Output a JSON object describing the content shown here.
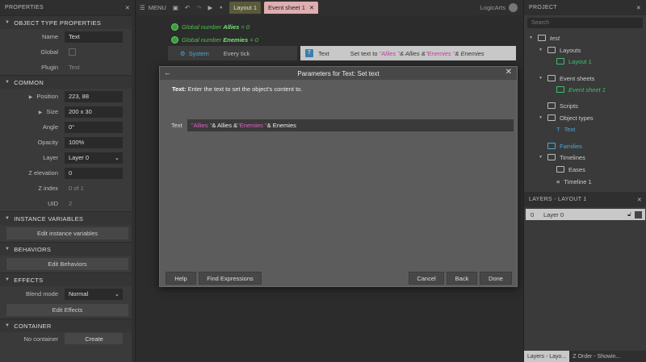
{
  "properties": {
    "title": "PROPERTIES",
    "object_type": {
      "header": "OBJECT TYPE PROPERTIES",
      "name_label": "Name",
      "name_value": "Text",
      "global_label": "Global",
      "plugin_label": "Plugin",
      "plugin_value": "Text"
    },
    "common": {
      "header": "COMMON",
      "position_label": "Position",
      "position_value": "223, 88",
      "size_label": "Size",
      "size_value": "200 x 30",
      "angle_label": "Angle",
      "angle_value": "0°",
      "opacity_label": "Opacity",
      "opacity_value": "100%",
      "layer_label": "Layer",
      "layer_value": "Layer 0",
      "zelev_label": "Z elevation",
      "zelev_value": "0",
      "zindex_label": "Z index",
      "zindex_value": "0 of 1",
      "uid_label": "UID",
      "uid_value": "2"
    },
    "instance_vars": {
      "header": "INSTANCE VARIABLES",
      "button": "Edit instance variables"
    },
    "behaviors": {
      "header": "BEHAVIORS",
      "button": "Edit Behaviors"
    },
    "effects": {
      "header": "EFFECTS",
      "blend_label": "Blend mode",
      "blend_value": "Normal",
      "button": "Edit Effects"
    },
    "container": {
      "header": "CONTAINER",
      "label": "No container",
      "button": "Create"
    }
  },
  "toolbar": {
    "menu": "MENU",
    "tab_layout": "Layout 1",
    "tab_sheet": "Event sheet 1",
    "brand": "LogicArts"
  },
  "sheet": {
    "global1": {
      "prefix": "Global number",
      "name": "Allies",
      "suffix": "= 0"
    },
    "global2": {
      "prefix": "Global number",
      "name": "Enemies",
      "suffix": "= 0"
    },
    "event": {
      "system": "System",
      "condition": "Every tick",
      "action_icon": "T",
      "action_object": "Text",
      "action_text": "Set text to",
      "action_str1": "\"Allies \"",
      "action_mid": " & Allies & ",
      "action_str2": "\"Enemies \"",
      "action_end": " & Enemies"
    }
  },
  "dialog": {
    "title": "Parameters for Text: Set text",
    "desc_label": "Text:",
    "desc_text": "Enter the text to set the object's content to.",
    "param_label": "Text",
    "param_str1": "\"Allies \"",
    "param_mid": " & Allies & ",
    "param_str2": "\"Enemies \"",
    "param_end": " & Enemies",
    "btn_help": "Help",
    "btn_find": "Find Expressions",
    "btn_cancel": "Cancel",
    "btn_back": "Back",
    "btn_done": "Done"
  },
  "project": {
    "title": "PROJECT",
    "search_placeholder": "Search",
    "root": "test",
    "layouts": "Layouts",
    "layout1": "Layout 1",
    "event_sheets": "Event sheets",
    "event_sheet1": "Event sheet 1",
    "scripts": "Scripts",
    "object_types": "Object types",
    "obj_text": "Text",
    "families": "Families",
    "timelines": "Timelines",
    "eases": "Eases",
    "timeline1": "Timeline 1"
  },
  "layers": {
    "title": "LAYERS - LAYOUT 1",
    "layer_index": "0",
    "layer_name": "Layer 0",
    "tab1": "Layers - Layo...",
    "tab2": "Z Order - Showin..."
  }
}
